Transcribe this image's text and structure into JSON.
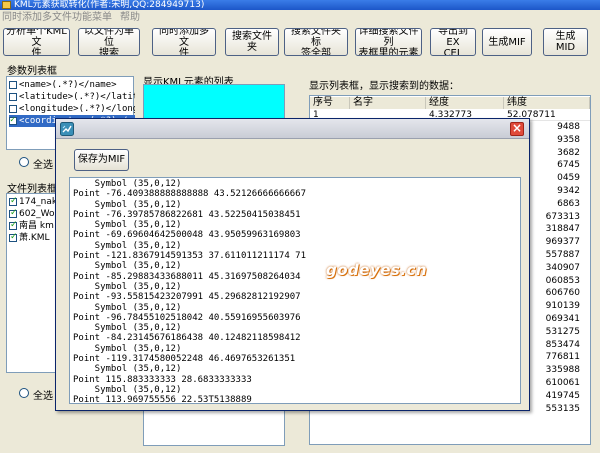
{
  "window": {
    "title": "KML元素获取转化(作者:宋明,QQ:284949713)"
  },
  "menu": [
    "同时添加多文件",
    "功能菜单",
    "帮助"
  ],
  "toolbar": [
    "分析单个KML文\n件",
    "以文件为单位\n搜索",
    "同时添加多文\n件",
    "搜索文件夹",
    "搜索文件夹标\n签全部",
    "详细搜索文件列\n表框里的元素",
    "导出到EX\nCEL",
    "生成MIF",
    "生成MID"
  ],
  "params": {
    "label": "参数列表框",
    "items": [
      {
        "text": "<name>(.*?)</name>",
        "checked": false,
        "selected": false
      },
      {
        "text": "<latitude>(.*?)</latitude>",
        "checked": false,
        "selected": false
      },
      {
        "text": "<longitude>(.*?)</longitude>",
        "checked": false,
        "selected": false
      },
      {
        "text": "<coordinates>(.*?)</coordinates>",
        "checked": true,
        "selected": true
      }
    ],
    "select_all": "全选"
  },
  "files": {
    "label": "文件列表框",
    "items": [
      {
        "text": "174_nak",
        "checked": true
      },
      {
        "text": "602_Wor",
        "checked": true
      },
      {
        "text": "南昌 km",
        "checked": true
      },
      {
        "text": "萧.KML",
        "checked": true
      }
    ],
    "select_all": "全选"
  },
  "kml_list": {
    "label": "显示KML元素的列表",
    "color": "#00ffff"
  },
  "grid": {
    "label": "显示列表框，显示搜索到的数据：",
    "columns": [
      "序号",
      "名字",
      "经度",
      "纬度"
    ],
    "first_row": [
      "1",
      "",
      "4.332773",
      "52.078711"
    ],
    "lat_tail": [
      "9488",
      "9358",
      "3682",
      "6745",
      "0459",
      "9342",
      "6863",
      "673313",
      "318847",
      "969377",
      "557887",
      "340907",
      "060853",
      "606760",
      "910139",
      "069341",
      "531275",
      "853474",
      "776811",
      "335988",
      "610061",
      "419745",
      "553135"
    ]
  },
  "dialog": {
    "save_label": "保存为MIF",
    "close": "×",
    "watermark": "godeyes.cn",
    "lines": [
      "    Symbol (35,0,12)",
      "Point -76.409388888888888 43.52126666666667",
      "    Symbol (35,0,12)",
      "Point -76.39785786822681 43.52250415038451",
      "    Symbol (35,0,12)",
      "Point -69.69604642500048 43.95059963169803",
      "    Symbol (35,0,12)",
      "Point -121.8367914591353 37.611011211174 71",
      "    Symbol (35,0,12)",
      "Point -85.29883433688011 45.31697508264034",
      "    Symbol (35,0,12)",
      "Point -93.55815423207991 45.29682812192907",
      "    Symbol (35,0,12)",
      "Point -96.78455102518042 40.55916955603976",
      "    Symbol (35,0,12)",
      "Point -84.23145676186438 40.12482118598412",
      "    Symbol (35,0,12)",
      "Point -119.3174580052248 46.4697653261351",
      "    Symbol (35,0,12)",
      "Point 115.883333333 28.6833333333",
      "    Symbol (35,0,12)",
      "Point 113.969755556 22.53T5138889",
      "    Symbol (35,0,12)"
    ]
  }
}
